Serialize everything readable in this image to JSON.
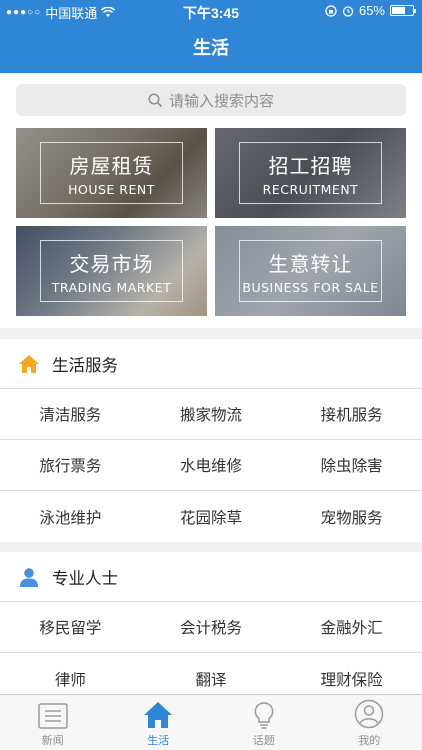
{
  "status_bar": {
    "carrier": "中国联通",
    "time": "下午3:45",
    "battery": "65%",
    "battery_level": 0.65
  },
  "header": {
    "title": "生活"
  },
  "search": {
    "placeholder": "请输入搜索内容"
  },
  "categories": [
    {
      "cn": "房屋租赁",
      "en": "HOUSE RENT"
    },
    {
      "cn": "招工招聘",
      "en": "RECRUITMENT"
    },
    {
      "cn": "交易市场",
      "en": "TRADING MARKET"
    },
    {
      "cn": "生意转让",
      "en": "BUSINESS FOR SALE"
    }
  ],
  "life_services": {
    "title": "生活服务",
    "rows": [
      [
        "清洁服务",
        "搬家物流",
        "接机服务"
      ],
      [
        "旅行票务",
        "水电维修",
        "除虫除害"
      ],
      [
        "泳池维护",
        "花园除草",
        "宠物服务"
      ]
    ]
  },
  "professionals": {
    "title": "专业人士",
    "rows": [
      [
        "移民留学",
        "会计税务",
        "金融外汇"
      ],
      [
        "律师",
        "翻译",
        "理财保险"
      ]
    ]
  },
  "tabbar": {
    "items": [
      {
        "label": "新闻",
        "icon": "news-icon"
      },
      {
        "label": "生活",
        "icon": "home-icon"
      },
      {
        "label": "话题",
        "icon": "lightbulb-icon"
      },
      {
        "label": "我的",
        "icon": "user-icon"
      }
    ],
    "active": "生活"
  },
  "colors": {
    "accent": "#2f86d6",
    "section_icon_home": "#f5a623",
    "section_icon_user": "#4a90e2"
  }
}
